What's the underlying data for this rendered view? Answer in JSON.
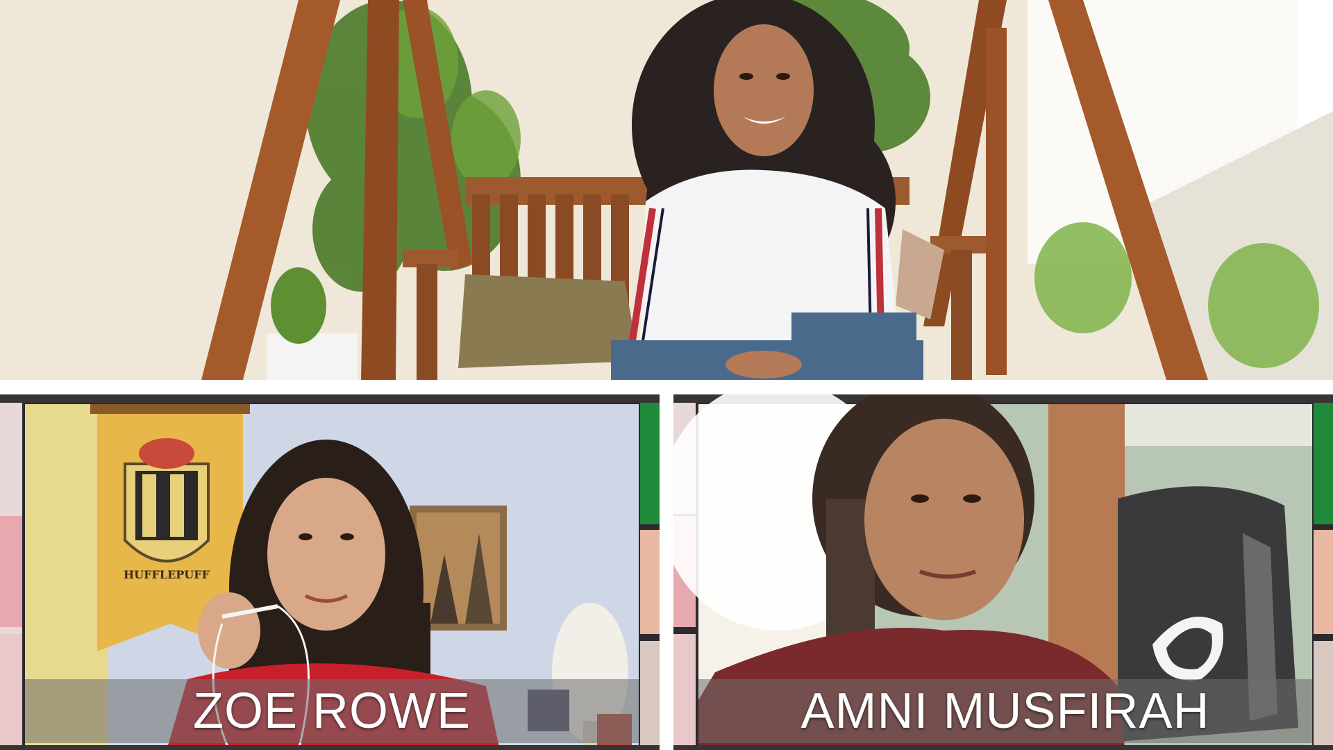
{
  "participants": [
    {
      "name": ""
    },
    {
      "name": "ZOE ROWE"
    },
    {
      "name": "AMNI MUSFIRAH"
    }
  ],
  "colors": {
    "background": "#ffffff",
    "caption_bar": "#6e6e6e",
    "caption_text": "#ffffff",
    "gallery_green": "#1f8a3a"
  },
  "banner": {
    "text": "HUFFLEPUFF"
  }
}
